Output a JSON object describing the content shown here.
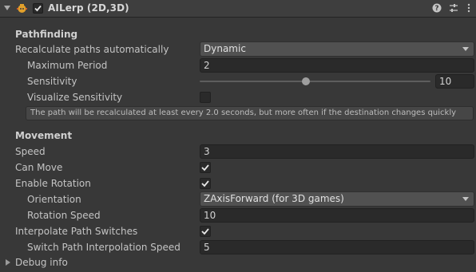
{
  "header": {
    "title": "AILerp (2D,3D)",
    "enabled": true,
    "icons": [
      "help-icon",
      "preset-sliders-icon",
      "kebab-menu-icon"
    ]
  },
  "pathfinding": {
    "section_title": "Pathfinding",
    "recalculate_label": "Recalculate paths automatically",
    "recalculate_value": "Dynamic",
    "max_period_label": "Maximum Period",
    "max_period_value": "2",
    "sensitivity_label": "Sensitivity",
    "sensitivity_value": "10",
    "sensitivity_fraction": 0.46,
    "visualize_label": "Visualize Sensitivity",
    "visualize_checked": false,
    "help_text": "The path will be recalculated at least every 2.0 seconds, but more often if the destination changes quickly"
  },
  "movement": {
    "section_title": "Movement",
    "speed_label": "Speed",
    "speed_value": "3",
    "can_move_label": "Can Move",
    "can_move_checked": true,
    "enable_rotation_label": "Enable Rotation",
    "enable_rotation_checked": true,
    "orientation_label": "Orientation",
    "orientation_value": "ZAxisForward (for 3D games)",
    "rotation_speed_label": "Rotation Speed",
    "rotation_speed_value": "10",
    "interpolate_label": "Interpolate Path Switches",
    "interpolate_checked": true,
    "switch_speed_label": "Switch Path Interpolation Speed",
    "switch_speed_value": "5"
  },
  "debug": {
    "label": "Debug info"
  },
  "colors": {
    "background": "#383838",
    "header": "#3e3e3e",
    "field": "#2a2a2a",
    "dropdown": "#515151",
    "text": "#c4c4c4"
  }
}
